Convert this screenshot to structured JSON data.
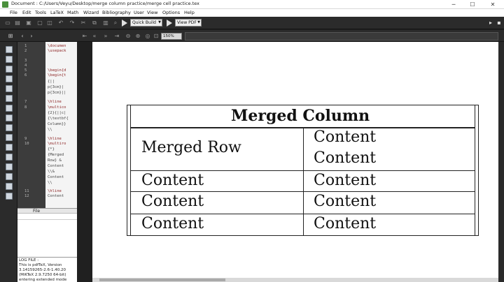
{
  "window": {
    "title": "Document : C:/Users/Veyu/Desktop/merge column practice/merge cell practice.tex",
    "minimize": "─",
    "maximize": "☐",
    "close": "✕"
  },
  "menu": [
    "File",
    "Edit",
    "Tools",
    "LaTeX",
    "Math",
    "Wizard",
    "Bibliography",
    "User",
    "View",
    "Options",
    "Help"
  ],
  "toolbar": {
    "build_label": "Quick Build",
    "view_label": "View PDF",
    "zoom": "150%"
  },
  "editor": {
    "line_numbers": [
      "1",
      "2",
      "3",
      "4",
      "5",
      "6",
      "",
      "",
      "7",
      "8",
      "",
      "",
      "",
      "9",
      "10",
      "",
      "",
      "",
      "",
      "",
      "",
      "11",
      "12"
    ],
    "code": [
      "\\documen",
      "\\usepack",
      "",
      "",
      "\\begin{d",
      "\\begin{t",
      "{||",
      "p{3cm}|",
      "p{3cm}||",
      "\\hline",
      "\\multico",
      "{2}{||c|",
      "{\\textbf{",
      "Column}}",
      "\\\\",
      "\\hline",
      "\\multiro",
      "{*}",
      "{Merged",
      "Row} &",
      "Content",
      "\\\\&",
      "Content",
      "\\\\",
      "\\hline",
      "Content"
    ]
  },
  "file_panel": {
    "header": "File"
  },
  "log": {
    "lines": [
      "LOG FILE :",
      "This is pdfTeX, Version",
      "3.14159265-2.6-1.40.20",
      "(MiKTeX 2.9.7250 64-bit)",
      "entering extended mode"
    ]
  },
  "document": {
    "header": "Merged Column",
    "merged_row": "Merged Row",
    "rows": [
      [
        "",
        "Content"
      ],
      [
        "",
        "Content"
      ],
      [
        "Content",
        "Content"
      ],
      [
        "Content",
        "Content"
      ],
      [
        "Content",
        "Content"
      ]
    ]
  }
}
